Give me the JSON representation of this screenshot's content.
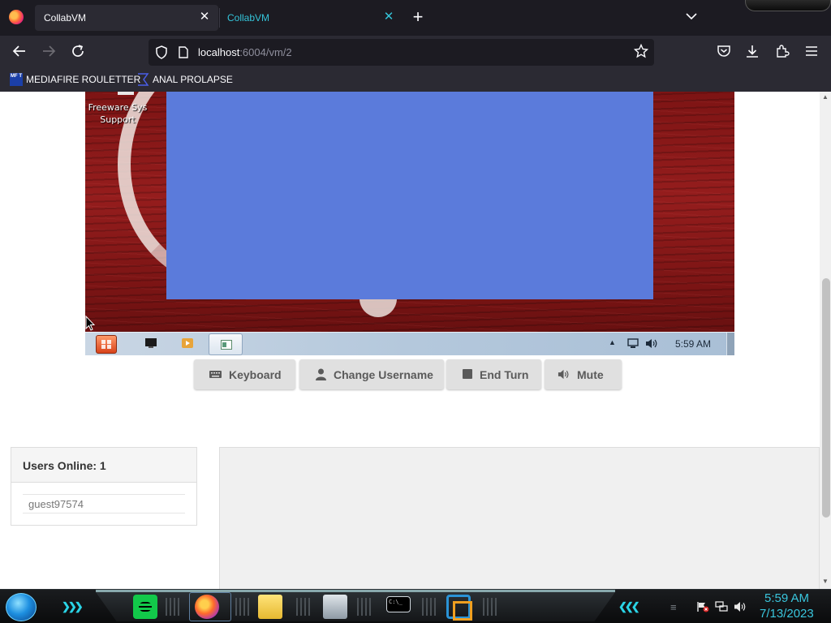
{
  "browser": {
    "tabs": [
      {
        "label": "CollabVM",
        "close": "✕"
      },
      {
        "label": "CollabVM",
        "close": "✕"
      }
    ],
    "new_tab": "+",
    "tab_list": "⌄",
    "url_host": "localhost",
    "url_rest": ":6004/vm/2",
    "bookmarks": [
      {
        "label": "MEDIAFIRE ROULETTER",
        "icon": "MF T"
      },
      {
        "label": "ANAL PROLAPSE"
      }
    ]
  },
  "vm": {
    "desktop_icon_label": "Freeware Sys Support",
    "clock": "5:59 AM",
    "wallpaper_color": "#8a1818",
    "window_color": "#5b7bdb"
  },
  "controls": [
    {
      "label": "Keyboard",
      "icon": "keyboard-icon"
    },
    {
      "label": "Change Username",
      "icon": "user-icon"
    },
    {
      "label": "End Turn",
      "icon": "stop-icon"
    },
    {
      "label": "Mute",
      "icon": "volume-icon"
    }
  ],
  "users": {
    "title": "Users Online: 1",
    "list": [
      "guest97574"
    ]
  },
  "host_taskbar": {
    "time": "5:59 AM",
    "date": "7/13/2023",
    "accent": "#39c6dd"
  }
}
